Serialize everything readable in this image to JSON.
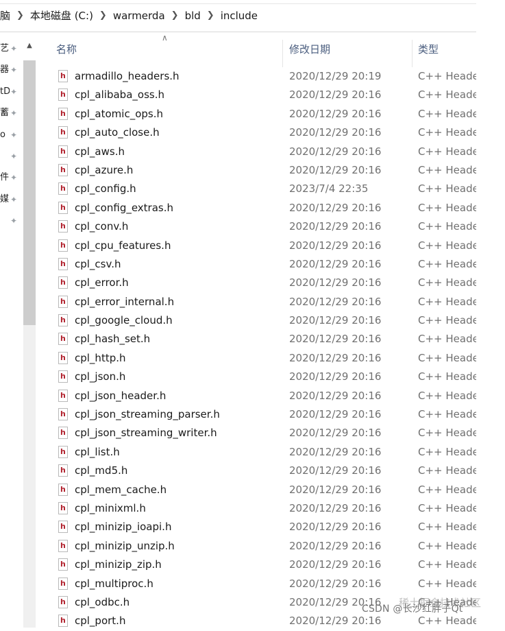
{
  "breadcrumb": [
    "脑",
    "本地磁盘 (C:)",
    "warmerda",
    "bld",
    "include"
  ],
  "nav": {
    "items": [
      "艺",
      "器",
      "tD",
      "蓄",
      "o",
      "",
      "件",
      "媒",
      ""
    ]
  },
  "columns": {
    "name": "名称",
    "date": "修改日期",
    "type": "类型"
  },
  "files": [
    {
      "name": "armadillo_headers.h",
      "date": "2020/12/29 20:19",
      "type": "C++ Header"
    },
    {
      "name": "cpl_alibaba_oss.h",
      "date": "2020/12/29 20:16",
      "type": "C++ Header"
    },
    {
      "name": "cpl_atomic_ops.h",
      "date": "2020/12/29 20:16",
      "type": "C++ Header"
    },
    {
      "name": "cpl_auto_close.h",
      "date": "2020/12/29 20:16",
      "type": "C++ Header"
    },
    {
      "name": "cpl_aws.h",
      "date": "2020/12/29 20:16",
      "type": "C++ Header"
    },
    {
      "name": "cpl_azure.h",
      "date": "2020/12/29 20:16",
      "type": "C++ Header"
    },
    {
      "name": "cpl_config.h",
      "date": "2023/7/4 22:35",
      "type": "C++ Header"
    },
    {
      "name": "cpl_config_extras.h",
      "date": "2020/12/29 20:16",
      "type": "C++ Header"
    },
    {
      "name": "cpl_conv.h",
      "date": "2020/12/29 20:16",
      "type": "C++ Header"
    },
    {
      "name": "cpl_cpu_features.h",
      "date": "2020/12/29 20:16",
      "type": "C++ Header"
    },
    {
      "name": "cpl_csv.h",
      "date": "2020/12/29 20:16",
      "type": "C++ Header"
    },
    {
      "name": "cpl_error.h",
      "date": "2020/12/29 20:16",
      "type": "C++ Header"
    },
    {
      "name": "cpl_error_internal.h",
      "date": "2020/12/29 20:16",
      "type": "C++ Header"
    },
    {
      "name": "cpl_google_cloud.h",
      "date": "2020/12/29 20:16",
      "type": "C++ Header"
    },
    {
      "name": "cpl_hash_set.h",
      "date": "2020/12/29 20:16",
      "type": "C++ Header"
    },
    {
      "name": "cpl_http.h",
      "date": "2020/12/29 20:16",
      "type": "C++ Header"
    },
    {
      "name": "cpl_json.h",
      "date": "2020/12/29 20:16",
      "type": "C++ Header"
    },
    {
      "name": "cpl_json_header.h",
      "date": "2020/12/29 20:16",
      "type": "C++ Header"
    },
    {
      "name": "cpl_json_streaming_parser.h",
      "date": "2020/12/29 20:16",
      "type": "C++ Header"
    },
    {
      "name": "cpl_json_streaming_writer.h",
      "date": "2020/12/29 20:16",
      "type": "C++ Header"
    },
    {
      "name": "cpl_list.h",
      "date": "2020/12/29 20:16",
      "type": "C++ Header"
    },
    {
      "name": "cpl_md5.h",
      "date": "2020/12/29 20:16",
      "type": "C++ Header"
    },
    {
      "name": "cpl_mem_cache.h",
      "date": "2020/12/29 20:16",
      "type": "C++ Header"
    },
    {
      "name": "cpl_minixml.h",
      "date": "2020/12/29 20:16",
      "type": "C++ Header"
    },
    {
      "name": "cpl_minizip_ioapi.h",
      "date": "2020/12/29 20:16",
      "type": "C++ Header"
    },
    {
      "name": "cpl_minizip_unzip.h",
      "date": "2020/12/29 20:16",
      "type": "C++ Header"
    },
    {
      "name": "cpl_minizip_zip.h",
      "date": "2020/12/29 20:16",
      "type": "C++ Header"
    },
    {
      "name": "cpl_multiproc.h",
      "date": "2020/12/29 20:16",
      "type": "C++ Header"
    },
    {
      "name": "cpl_odbc.h",
      "date": "2020/12/29 20:16",
      "type": "C++ Header"
    },
    {
      "name": "cpl_port.h",
      "date": "2020/12/29 20:16",
      "type": "C++ Header"
    }
  ],
  "watermark": "CSDN @长沙红胖子Qt",
  "watermark_bg": "稀土掘金技术社区"
}
